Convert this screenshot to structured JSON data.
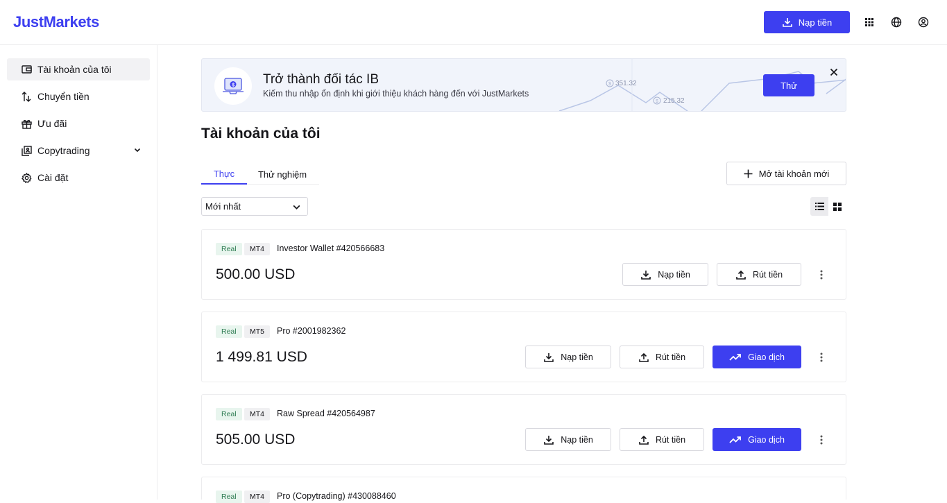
{
  "brand": {
    "logo": "JustMarkets",
    "accent": "#3d3ff0"
  },
  "header": {
    "deposit_label": "Nạp tiền",
    "icons": [
      "apps-grid-icon",
      "globe-icon",
      "user-icon"
    ]
  },
  "sidebar": {
    "items": [
      {
        "label": "Tài khoản của tôi",
        "icon": "wallet-icon",
        "active": true
      },
      {
        "label": "Chuyển tiền",
        "icon": "transfer-icon"
      },
      {
        "label": "Ưu đãi",
        "icon": "gift-icon"
      },
      {
        "label": "Copytrading",
        "icon": "copytrading-icon",
        "expandable": true
      },
      {
        "label": "Cài đặt",
        "icon": "gear-icon"
      }
    ]
  },
  "banner": {
    "title": "Trở thành đối tác IB",
    "subtitle": "Kiếm thu nhập ổn định khi giới thiệu khách hàng đến với JustMarkets",
    "value_1": "351.32",
    "value_2": "215.32",
    "try_label": "Thử"
  },
  "page": {
    "title": "Tài khoản của tôi"
  },
  "tabs": [
    {
      "label": "Thực",
      "active": true
    },
    {
      "label": "Thử nghiệm",
      "active": false
    }
  ],
  "actions": {
    "new_account_label": "Mở tài khoản mới"
  },
  "sort": {
    "selected": "Mới nhất"
  },
  "view": {
    "mode": "list"
  },
  "accounts": [
    {
      "type": "Real",
      "platform": "MT4",
      "name": "Investor Wallet #420566683",
      "balance": "500.00 USD",
      "deposit_label": "Nạp tiền",
      "withdraw_label": "Rút tiền"
    },
    {
      "type": "Real",
      "platform": "MT5",
      "name": "Pro #2001982362",
      "balance": "1 499.81 USD",
      "deposit_label": "Nạp tiền",
      "withdraw_label": "Rút tiền",
      "trade_label": "Giao dịch"
    },
    {
      "type": "Real",
      "platform": "MT4",
      "name": "Raw Spread #420564987",
      "balance": "505.00 USD",
      "deposit_label": "Nạp tiền",
      "withdraw_label": "Rút tiền",
      "trade_label": "Giao dịch"
    },
    {
      "type": "Real",
      "platform": "MT4",
      "name": "Pro (Copytrading) #430088460"
    }
  ]
}
